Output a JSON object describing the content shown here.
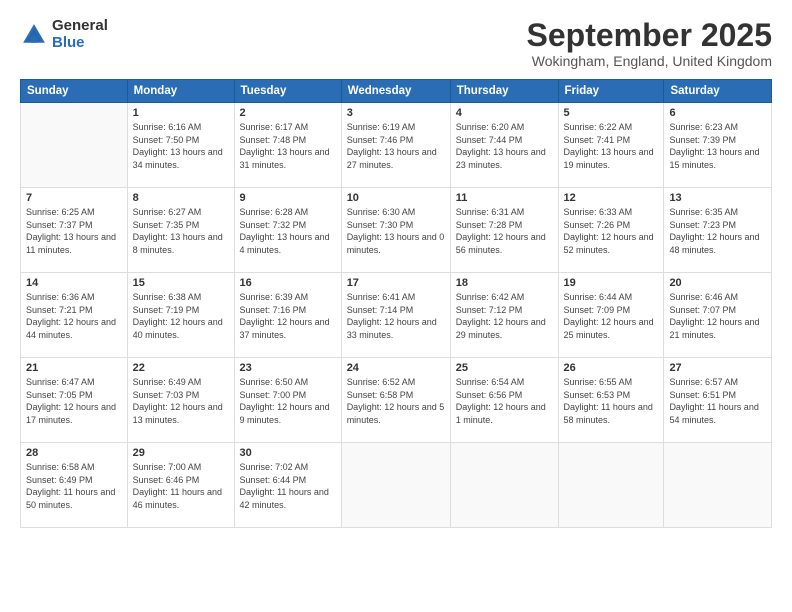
{
  "header": {
    "logo_line1": "General",
    "logo_line2": "Blue",
    "month_title": "September 2025",
    "location": "Wokingham, England, United Kingdom"
  },
  "weekdays": [
    "Sunday",
    "Monday",
    "Tuesday",
    "Wednesday",
    "Thursday",
    "Friday",
    "Saturday"
  ],
  "weeks": [
    [
      {
        "day": "",
        "sunrise": "",
        "sunset": "",
        "daylight": ""
      },
      {
        "day": "1",
        "sunrise": "Sunrise: 6:16 AM",
        "sunset": "Sunset: 7:50 PM",
        "daylight": "Daylight: 13 hours and 34 minutes."
      },
      {
        "day": "2",
        "sunrise": "Sunrise: 6:17 AM",
        "sunset": "Sunset: 7:48 PM",
        "daylight": "Daylight: 13 hours and 31 minutes."
      },
      {
        "day": "3",
        "sunrise": "Sunrise: 6:19 AM",
        "sunset": "Sunset: 7:46 PM",
        "daylight": "Daylight: 13 hours and 27 minutes."
      },
      {
        "day": "4",
        "sunrise": "Sunrise: 6:20 AM",
        "sunset": "Sunset: 7:44 PM",
        "daylight": "Daylight: 13 hours and 23 minutes."
      },
      {
        "day": "5",
        "sunrise": "Sunrise: 6:22 AM",
        "sunset": "Sunset: 7:41 PM",
        "daylight": "Daylight: 13 hours and 19 minutes."
      },
      {
        "day": "6",
        "sunrise": "Sunrise: 6:23 AM",
        "sunset": "Sunset: 7:39 PM",
        "daylight": "Daylight: 13 hours and 15 minutes."
      }
    ],
    [
      {
        "day": "7",
        "sunrise": "Sunrise: 6:25 AM",
        "sunset": "Sunset: 7:37 PM",
        "daylight": "Daylight: 13 hours and 11 minutes."
      },
      {
        "day": "8",
        "sunrise": "Sunrise: 6:27 AM",
        "sunset": "Sunset: 7:35 PM",
        "daylight": "Daylight: 13 hours and 8 minutes."
      },
      {
        "day": "9",
        "sunrise": "Sunrise: 6:28 AM",
        "sunset": "Sunset: 7:32 PM",
        "daylight": "Daylight: 13 hours and 4 minutes."
      },
      {
        "day": "10",
        "sunrise": "Sunrise: 6:30 AM",
        "sunset": "Sunset: 7:30 PM",
        "daylight": "Daylight: 13 hours and 0 minutes."
      },
      {
        "day": "11",
        "sunrise": "Sunrise: 6:31 AM",
        "sunset": "Sunset: 7:28 PM",
        "daylight": "Daylight: 12 hours and 56 minutes."
      },
      {
        "day": "12",
        "sunrise": "Sunrise: 6:33 AM",
        "sunset": "Sunset: 7:26 PM",
        "daylight": "Daylight: 12 hours and 52 minutes."
      },
      {
        "day": "13",
        "sunrise": "Sunrise: 6:35 AM",
        "sunset": "Sunset: 7:23 PM",
        "daylight": "Daylight: 12 hours and 48 minutes."
      }
    ],
    [
      {
        "day": "14",
        "sunrise": "Sunrise: 6:36 AM",
        "sunset": "Sunset: 7:21 PM",
        "daylight": "Daylight: 12 hours and 44 minutes."
      },
      {
        "day": "15",
        "sunrise": "Sunrise: 6:38 AM",
        "sunset": "Sunset: 7:19 PM",
        "daylight": "Daylight: 12 hours and 40 minutes."
      },
      {
        "day": "16",
        "sunrise": "Sunrise: 6:39 AM",
        "sunset": "Sunset: 7:16 PM",
        "daylight": "Daylight: 12 hours and 37 minutes."
      },
      {
        "day": "17",
        "sunrise": "Sunrise: 6:41 AM",
        "sunset": "Sunset: 7:14 PM",
        "daylight": "Daylight: 12 hours and 33 minutes."
      },
      {
        "day": "18",
        "sunrise": "Sunrise: 6:42 AM",
        "sunset": "Sunset: 7:12 PM",
        "daylight": "Daylight: 12 hours and 29 minutes."
      },
      {
        "day": "19",
        "sunrise": "Sunrise: 6:44 AM",
        "sunset": "Sunset: 7:09 PM",
        "daylight": "Daylight: 12 hours and 25 minutes."
      },
      {
        "day": "20",
        "sunrise": "Sunrise: 6:46 AM",
        "sunset": "Sunset: 7:07 PM",
        "daylight": "Daylight: 12 hours and 21 minutes."
      }
    ],
    [
      {
        "day": "21",
        "sunrise": "Sunrise: 6:47 AM",
        "sunset": "Sunset: 7:05 PM",
        "daylight": "Daylight: 12 hours and 17 minutes."
      },
      {
        "day": "22",
        "sunrise": "Sunrise: 6:49 AM",
        "sunset": "Sunset: 7:03 PM",
        "daylight": "Daylight: 12 hours and 13 minutes."
      },
      {
        "day": "23",
        "sunrise": "Sunrise: 6:50 AM",
        "sunset": "Sunset: 7:00 PM",
        "daylight": "Daylight: 12 hours and 9 minutes."
      },
      {
        "day": "24",
        "sunrise": "Sunrise: 6:52 AM",
        "sunset": "Sunset: 6:58 PM",
        "daylight": "Daylight: 12 hours and 5 minutes."
      },
      {
        "day": "25",
        "sunrise": "Sunrise: 6:54 AM",
        "sunset": "Sunset: 6:56 PM",
        "daylight": "Daylight: 12 hours and 1 minute."
      },
      {
        "day": "26",
        "sunrise": "Sunrise: 6:55 AM",
        "sunset": "Sunset: 6:53 PM",
        "daylight": "Daylight: 11 hours and 58 minutes."
      },
      {
        "day": "27",
        "sunrise": "Sunrise: 6:57 AM",
        "sunset": "Sunset: 6:51 PM",
        "daylight": "Daylight: 11 hours and 54 minutes."
      }
    ],
    [
      {
        "day": "28",
        "sunrise": "Sunrise: 6:58 AM",
        "sunset": "Sunset: 6:49 PM",
        "daylight": "Daylight: 11 hours and 50 minutes."
      },
      {
        "day": "29",
        "sunrise": "Sunrise: 7:00 AM",
        "sunset": "Sunset: 6:46 PM",
        "daylight": "Daylight: 11 hours and 46 minutes."
      },
      {
        "day": "30",
        "sunrise": "Sunrise: 7:02 AM",
        "sunset": "Sunset: 6:44 PM",
        "daylight": "Daylight: 11 hours and 42 minutes."
      },
      {
        "day": "",
        "sunrise": "",
        "sunset": "",
        "daylight": ""
      },
      {
        "day": "",
        "sunrise": "",
        "sunset": "",
        "daylight": ""
      },
      {
        "day": "",
        "sunrise": "",
        "sunset": "",
        "daylight": ""
      },
      {
        "day": "",
        "sunrise": "",
        "sunset": "",
        "daylight": ""
      }
    ]
  ]
}
